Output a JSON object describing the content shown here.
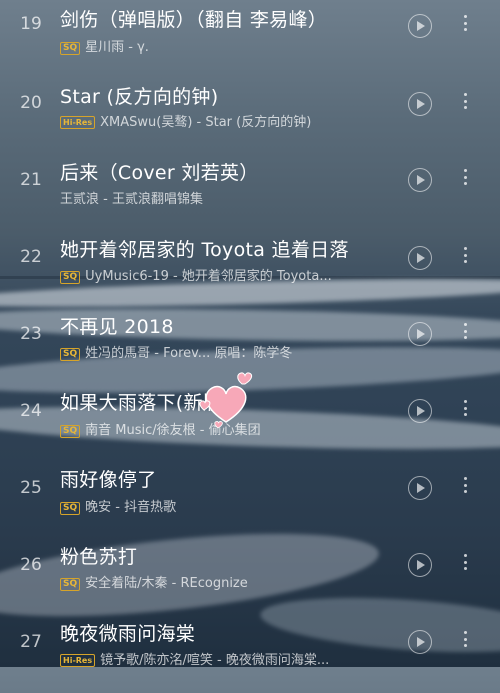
{
  "songs": [
    {
      "num": "19",
      "title": "剑伤（弹唱版）（翻自 李易峰）",
      "badge": "SQ",
      "subtitle": "星川雨 - γ."
    },
    {
      "num": "20",
      "title": "Star (反方向的钟)",
      "badge": "Hi-Res",
      "subtitle": "XMASwu(吴骜) - Star (反方向的钟)"
    },
    {
      "num": "21",
      "title": "后来（Cover 刘若英）",
      "badge": "",
      "subtitle": "王贰浪 - 王贰浪翻唱锦集"
    },
    {
      "num": "22",
      "title": "她开着邻居家的 Toyota 追着日落",
      "badge": "SQ",
      "subtitle": "UyMusic6-19 - 她开着邻居家的 Toyota..."
    },
    {
      "num": "23",
      "title": "不再见 2018",
      "badge": "SQ",
      "subtitle": "姓冯的馬哥 - Forev...   原唱：陈学冬"
    },
    {
      "num": "24",
      "title": "如果大雨落下(新版)",
      "badge": "SQ",
      "subtitle": "南音 Music/徐友根 - 偷心集团"
    },
    {
      "num": "25",
      "title": "雨好像停了",
      "badge": "SQ",
      "subtitle": "晚安 - 抖音热歌"
    },
    {
      "num": "26",
      "title": "粉色苏打",
      "badge": "SQ",
      "subtitle": "安全着陆/木秦 - REcognize"
    },
    {
      "num": "27",
      "title": "晚夜微雨问海棠",
      "badge": "Hi-Res",
      "subtitle": "镜予歌/陈亦洺/喧笑 - 晚夜微雨问海棠..."
    }
  ],
  "icons": {
    "play": "play-circle-icon",
    "more": "more-vertical-icon",
    "sticker": "hearts-sticker-icon"
  },
  "colors": {
    "badge": "#e7b638",
    "text": "#ffffff"
  }
}
